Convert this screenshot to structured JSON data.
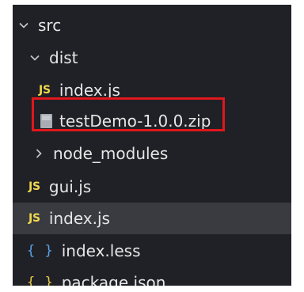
{
  "explorer": {
    "items": [
      {
        "label": "src",
        "kind": "folder-open",
        "icon": "chevron-down-icon"
      },
      {
        "label": "dist",
        "kind": "folder-open",
        "icon": "chevron-down-icon"
      },
      {
        "label": "index.js",
        "kind": "file",
        "icon": "js-file-icon",
        "icon_text": "JS"
      },
      {
        "label": "testDemo-1.0.0.zip",
        "kind": "file",
        "icon": "zip-file-icon"
      },
      {
        "label": "node_modules",
        "kind": "folder-collapsed",
        "icon": "chevron-right-icon"
      },
      {
        "label": "gui.js",
        "kind": "file",
        "icon": "js-file-icon",
        "icon_text": "JS"
      },
      {
        "label": "index.js",
        "kind": "file",
        "icon": "js-file-icon",
        "icon_text": "JS",
        "selected": true
      },
      {
        "label": "index.less",
        "kind": "file",
        "icon": "braces-file-icon",
        "icon_text": "{ }"
      },
      {
        "label": "package.json",
        "kind": "file",
        "icon": "braces-file-icon",
        "icon_text": "{ }"
      }
    ]
  },
  "colors": {
    "background": "#202126",
    "selected_row": "#3a3b41",
    "text": "#e6e6e6",
    "js_icon": "#f1d84b",
    "less_icon": "#5aa1e6",
    "json_icon": "#e9c84a",
    "highlight_box": "#e0171b"
  }
}
